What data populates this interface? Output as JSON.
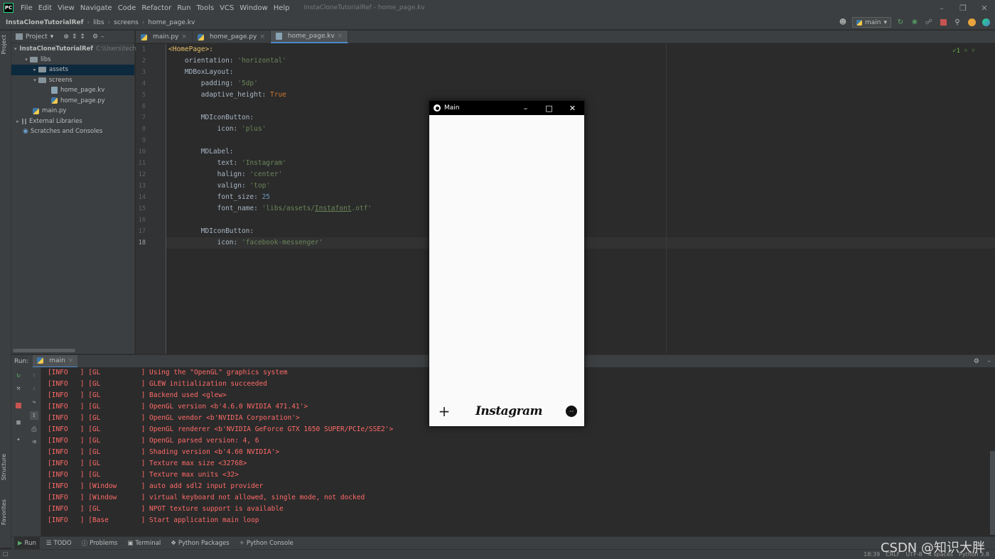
{
  "app": {
    "logo": "PC",
    "window_title": "InstaCloneTutorialRef - home_page.kv",
    "menu": [
      "File",
      "Edit",
      "View",
      "Navigate",
      "Code",
      "Refactor",
      "Run",
      "Tools",
      "VCS",
      "Window",
      "Help"
    ]
  },
  "breadcrumb": [
    "InstaCloneTutorialRef",
    "libs",
    "screens",
    "home_page.kv"
  ],
  "run_config": {
    "label": "main"
  },
  "sidebar_tabs": {
    "project": "Project",
    "structure": "Structure",
    "favorites": "Favorites"
  },
  "project_panel": {
    "title": "Project",
    "tree": [
      {
        "label": "InstaCloneTutorialRef",
        "hint": "C:\\Users\\tech"
      },
      {
        "label": "libs"
      },
      {
        "label": "assets"
      },
      {
        "label": "screens"
      },
      {
        "label": "home_page.kv"
      },
      {
        "label": "home_page.py"
      },
      {
        "label": "main.py"
      },
      {
        "label": "External Libraries"
      },
      {
        "label": "Scratches and Consoles"
      }
    ]
  },
  "editor_tabs": [
    {
      "label": "main.py"
    },
    {
      "label": "home_page.py"
    },
    {
      "label": "home_page.kv"
    }
  ],
  "editor": {
    "inspection_count": "1",
    "line_numbers": [
      "1",
      "2",
      "3",
      "4",
      "5",
      "6",
      "7",
      "8",
      "9",
      "10",
      "11",
      "12",
      "13",
      "14",
      "15",
      "16",
      "17",
      "18"
    ],
    "code": {
      "l1": "<HomePage>:",
      "l2_key": "orientation: ",
      "l2_val": "'horizontal'",
      "l3": "MDBoxLayout:",
      "l4_key": "padding: ",
      "l4_val": "'5dp'",
      "l5_key": "adaptive_height: ",
      "l5_val": "True",
      "l7": "MDIconButton:",
      "l8_key": "icon: ",
      "l8_val": "'plus'",
      "l10": "MDLabel:",
      "l11_key": "text: ",
      "l11_val": "'Instagram'",
      "l12_key": "halign: ",
      "l12_val": "'center'",
      "l13_key": "valign: ",
      "l13_val": "'top'",
      "l14_key": "font_size: ",
      "l14_val": "25",
      "l15_key": "font_name: ",
      "l15_val_a": "'libs/assets/",
      "l15_val_b": "Instafont",
      "l15_val_c": ".otf'",
      "l17": "MDIconButton:",
      "l18_key": "icon: ",
      "l18_val": "'facebook-messenger'"
    }
  },
  "run_panel": {
    "label": "Run:",
    "tab": "main",
    "log": [
      {
        "level": "[INFO   ]",
        "src": "[GL          ]",
        "msg": "Using the \"OpenGL\" graphics system"
      },
      {
        "level": "[INFO   ]",
        "src": "[GL          ]",
        "msg": "GLEW initialization succeeded"
      },
      {
        "level": "[INFO   ]",
        "src": "[GL          ]",
        "msg": "Backend used <glew>"
      },
      {
        "level": "[INFO   ]",
        "src": "[GL          ]",
        "msg": "OpenGL version <b'4.6.0 NVIDIA 471.41'>"
      },
      {
        "level": "[INFO   ]",
        "src": "[GL          ]",
        "msg": "OpenGL vendor <b'NVIDIA Corporation'>"
      },
      {
        "level": "[INFO   ]",
        "src": "[GL          ]",
        "msg": "OpenGL renderer <b'NVIDIA GeForce GTX 1650 SUPER/PCIe/SSE2'>"
      },
      {
        "level": "[INFO   ]",
        "src": "[GL          ]",
        "msg": "OpenGL parsed version: 4, 6"
      },
      {
        "level": "[INFO   ]",
        "src": "[GL          ]",
        "msg": "Shading version <b'4.60 NVIDIA'>"
      },
      {
        "level": "[INFO   ]",
        "src": "[GL          ]",
        "msg": "Texture max size <32768>"
      },
      {
        "level": "[INFO   ]",
        "src": "[GL          ]",
        "msg": "Texture max units <32>"
      },
      {
        "level": "[INFO   ]",
        "src": "[Window      ]",
        "msg": "auto add sdl2 input provider"
      },
      {
        "level": "[INFO   ]",
        "src": "[Window      ]",
        "msg": "virtual keyboard not allowed, single mode, not docked"
      },
      {
        "level": "[INFO   ]",
        "src": "[GL          ]",
        "msg": "NPOT texture support is available"
      },
      {
        "level": "[INFO   ]",
        "src": "[Base        ]",
        "msg": "Start application main loop"
      }
    ]
  },
  "bottom_tabs": [
    "Run",
    "TODO",
    "Problems",
    "Terminal",
    "Python Packages",
    "Python Console"
  ],
  "status": {
    "position": "18:39",
    "line_sep": "CRLF",
    "encoding": "UTF-8",
    "indent": "4 spaces",
    "interpreter": "Python 3.8"
  },
  "watermark": "CSDN @知识大胖",
  "kivy_app": {
    "title": "Main",
    "label": "Instagram"
  }
}
